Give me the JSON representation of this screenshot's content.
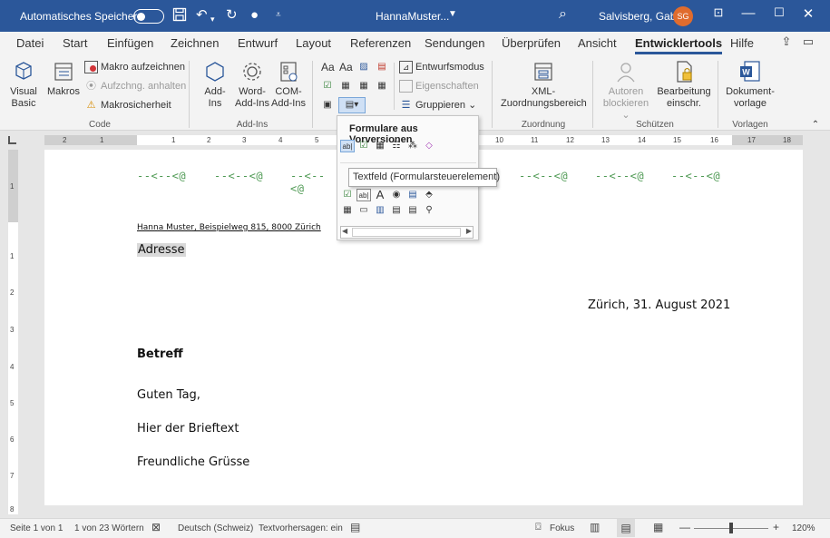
{
  "titlebar": {
    "autosave_label": "Automatisches Speichern",
    "doc_name": "HannaMuster...",
    "user": "Salvisberg, Gaby",
    "avatar": "SG",
    "save_icon": "save-icon",
    "undo_icon": "undo-icon",
    "redo_icon": "redo-icon"
  },
  "tabs": [
    "Datei",
    "Start",
    "Einfügen",
    "Zeichnen",
    "Entwurf",
    "Layout",
    "Referenzen",
    "Sendungen",
    "Überprüfen",
    "Ansicht",
    "Entwicklertools",
    "Hilfe"
  ],
  "active_tab": "Entwicklertools",
  "ribbon": {
    "code": {
      "label": "Code",
      "visual_basic": [
        "Visual",
        "Basic"
      ],
      "macros": "Makros",
      "record": "Makro aufzeichnen",
      "pause": "Aufzchng. anhalten",
      "security": "Makrosicherheit"
    },
    "addins": {
      "label": "Add-Ins",
      "addins": [
        "Add-",
        "Ins"
      ],
      "word_addins": [
        "Word-",
        "Add-Ins"
      ],
      "com_addins": [
        "COM-",
        "Add-Ins"
      ]
    },
    "controls": {
      "aa1": "Aa",
      "aa2": "Aa",
      "design_mode": "Entwurfsmodus",
      "properties": "Eigenschaften",
      "group": "Gruppieren"
    },
    "mapping": {
      "label": "Zuordnung",
      "xml": [
        "XML-",
        "Zuordnungsbereich"
      ]
    },
    "protect": {
      "label": "Schützen",
      "block_authors": [
        "Autoren",
        "blockieren"
      ],
      "restrict": [
        "Bearbeitung",
        "einschr."
      ]
    },
    "templates": {
      "label": "Vorlagen",
      "doc_template": [
        "Dokument-",
        "vorlage"
      ]
    }
  },
  "dropdown": {
    "title": "Formulare aus Vorversionen",
    "tooltip": "Textfeld (Formularsteuerelement)",
    "row1": [
      "ab|",
      "☑",
      "▦",
      "☷",
      "⁂",
      "◇"
    ],
    "row2": [
      "☑",
      "ab|",
      "A",
      "◉",
      "▤",
      "⬘"
    ],
    "row3": [
      "▦",
      "▭",
      "▥",
      "▤",
      "▤",
      "⚲"
    ]
  },
  "ruler": {
    "h_numbers": [
      "2",
      "1",
      "1",
      "2",
      "3",
      "4",
      "5",
      "10",
      "11",
      "12",
      "13",
      "14",
      "15",
      "16",
      "17",
      "18"
    ],
    "v_numbers": [
      "1",
      "1",
      "2",
      "3",
      "4",
      "5",
      "6",
      "7",
      "8"
    ]
  },
  "document": {
    "pattern": "--<--<@",
    "sender": "Hanna Muster, Beispielweg 815, 8000 Zürich",
    "address": "Adresse",
    "date": "Zürich, 31. August 2021",
    "subject": "Betreff",
    "greeting": "Guten Tag,",
    "body": "Hier der Brieftext",
    "closing": "Freundliche Grüsse"
  },
  "status": {
    "page": "Seite 1 von 1",
    "words": "1 von 23 Wörtern",
    "language": "Deutsch (Schweiz)",
    "predictions": "Textvorhersagen: ein",
    "focus": "Fokus",
    "zoom": "120%"
  },
  "colors": {
    "accent": "#2b579a",
    "pattern_green": "#4f9a54",
    "avatar": "#e06c2e"
  }
}
